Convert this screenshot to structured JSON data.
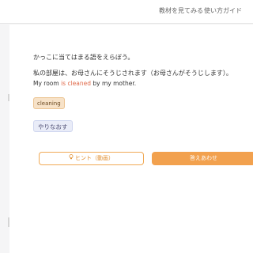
{
  "header": {
    "materials_link": "教材を見てみる",
    "guide_link": "使い方ガイド"
  },
  "question": {
    "instruction": "かっこに当てはまる語をえらぼう。",
    "japanese": "私の部屋は、お母さんにそうじされます（お母さんがそうじします）。",
    "english_before": "My room ",
    "english_highlight": "is cleaned",
    "english_after": " by my mother."
  },
  "choices": {
    "answer_chip": "cleaning",
    "redo_label": "やりなおす"
  },
  "actions": {
    "hint_icon": "lightbulb-icon",
    "hint_label": "ヒント（動画）",
    "answer_label": "答えあわせ"
  },
  "colors": {
    "accent": "#f2a14e",
    "highlight": "#e06a4a"
  }
}
